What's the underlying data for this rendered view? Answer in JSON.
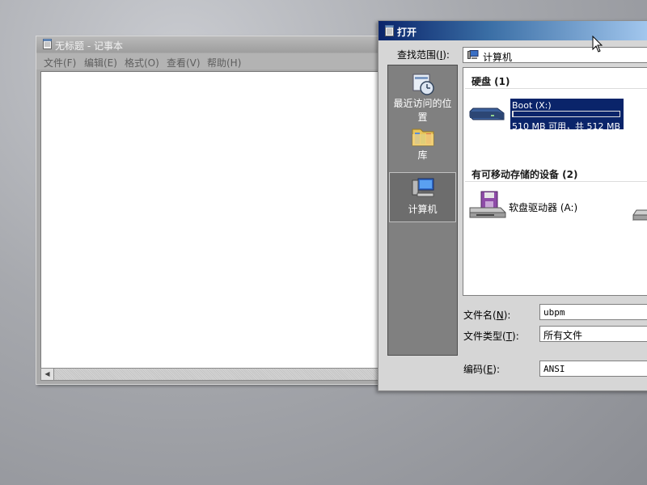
{
  "notepad": {
    "title": "无标题 - 记事本",
    "menu": [
      "文件(F)",
      "编辑(E)",
      "格式(O)",
      "查看(V)",
      "帮助(H)"
    ],
    "scroll_left": "◀"
  },
  "open_dialog": {
    "title": "打开",
    "look_in": {
      "label": "查找范围",
      "key": "I",
      "value": "计算机"
    },
    "places": [
      {
        "label": "最近访问的位置",
        "icon": "recent-places-icon"
      },
      {
        "label": "库",
        "icon": "libraries-icon"
      },
      {
        "label": "计算机",
        "icon": "computer-icon"
      }
    ],
    "groups": {
      "hard_disks": "硬盘 (1)",
      "removable": "有可移动存储的设备 (2)"
    },
    "drives": {
      "boot": {
        "name": "Boot (X:)",
        "space": "510 MB 可用，共 512 MB",
        "used_fraction": 0.004
      },
      "floppy": {
        "name": "软盘驱动器 (A:)"
      }
    },
    "filename": {
      "label": "文件名",
      "key": "N",
      "value": "ubpm"
    },
    "filetype": {
      "label": "文件类型",
      "key": "T",
      "value": "所有文件"
    },
    "encoding": {
      "label": "编码",
      "key": "E",
      "value": "ANSI"
    }
  },
  "colors": {
    "title_active": "#0a246a",
    "selection": "#0a246a",
    "places_bg": "#808080"
  }
}
